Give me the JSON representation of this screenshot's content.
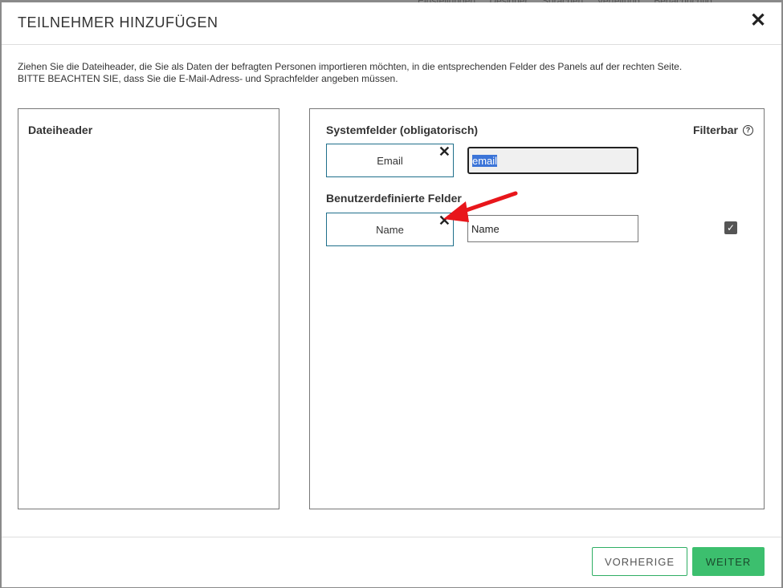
{
  "backdrop": {
    "nav": [
      "Einstellungen",
      "Designer",
      "Sprachen",
      "Verteilung",
      "Benachrichtig"
    ]
  },
  "modal": {
    "title": "TEILNEHMER HINZUFÜGEN",
    "close_icon": "close-icon",
    "intro_line1": "Ziehen Sie die Dateiheader, die Sie als Daten der befragten Personen importieren möchten, in die entsprechenden Felder des Panels auf der rechten Seite.",
    "intro_line2": "BITTE BEACHTEN SIE, dass Sie die E-Mail-Adress- und Sprachfelder angeben müssen."
  },
  "left_panel": {
    "title": "Dateiheader"
  },
  "right_panel": {
    "system_title": "Systemfelder (obligatorisch)",
    "filterbar_label": "Filterbar",
    "filterbar_icon": "help-icon",
    "system_fields": [
      {
        "chip_label": "Email",
        "value": "email",
        "selected": true
      }
    ],
    "custom_title": "Benutzerdefinierte Felder",
    "custom_fields": [
      {
        "chip_label": "Name",
        "value": "Name",
        "filterable": true
      }
    ]
  },
  "footer": {
    "prev_label": "VORHERIGE",
    "next_label": "WEITER"
  },
  "colors": {
    "accent_green": "#3cbf6e",
    "chip_border": "#1f6f8b",
    "annotation_arrow": "#e8161b"
  }
}
